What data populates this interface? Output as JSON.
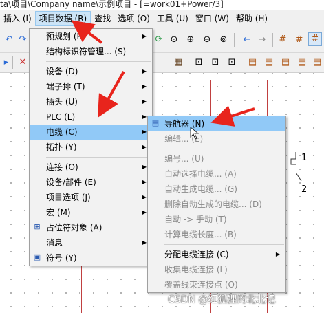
{
  "window": {
    "title": "ta\\项目\\Company name\\示例项目 - [=work01+Power/3]"
  },
  "menubar": [
    "插入 (I)",
    "项目数据 (R)",
    "查找",
    "选项 (O)",
    "工具 (U)",
    "窗口 (W)",
    "帮助 (H)"
  ],
  "menu_project": [
    {
      "label": "预规划 (P)",
      "sub": true
    },
    {
      "label": "结构标识符管理... (S)",
      "sub": false
    },
    {
      "sep": true
    },
    {
      "label": "设备 (D)",
      "sub": true
    },
    {
      "label": "端子排 (T)",
      "sub": true
    },
    {
      "label": "插头 (U)",
      "sub": true
    },
    {
      "label": "PLC (L)",
      "sub": true
    },
    {
      "label": "电缆 (C)",
      "sub": true,
      "highlight": true
    },
    {
      "label": "拓扑 (Y)",
      "sub": true
    },
    {
      "sep": true
    },
    {
      "label": "连接 (O)",
      "sub": true
    },
    {
      "label": "设备/部件 (E)",
      "sub": true
    },
    {
      "label": "项目选项 (J)",
      "sub": true
    },
    {
      "label": "宏 (M)",
      "sub": true
    },
    {
      "label": "占位符对象 (A)",
      "sub": false,
      "icon": "placeholder-object-icon"
    },
    {
      "label": "消息",
      "sub": true
    },
    {
      "label": "符号 (Y)",
      "sub": false,
      "icon": "symbol-icon"
    }
  ],
  "menu_cable": [
    {
      "label": "导航器 (N)",
      "highlight": true,
      "icon": "navigator-icon"
    },
    {
      "label": "编辑... (E)",
      "disabled": true
    },
    {
      "sep": true
    },
    {
      "label": "编号... (U)",
      "disabled": true
    },
    {
      "label": "自动选择电缆... (A)",
      "disabled": true
    },
    {
      "label": "自动生成电缆... (G)",
      "disabled": true
    },
    {
      "label": "删除自动生成的电缆... (D)",
      "disabled": true
    },
    {
      "label": "自动 -> 手动 (T)",
      "disabled": true
    },
    {
      "label": "计算电缆长度... (B)",
      "disabled": true
    },
    {
      "sep": true
    },
    {
      "label": "分配电缆连接 (C)",
      "sub": true
    },
    {
      "label": "收集电缆连接 (L)",
      "disabled": true
    },
    {
      "label": "覆盖线束连接点 (O)",
      "disabled": true
    }
  ],
  "canvas": {
    "pin1": "1",
    "pin2": "2"
  },
  "watermark": "CSDN @红狐狸的北北记",
  "colors": {
    "highlight": "#91c9f7",
    "annotation_arrow": "#e8241c",
    "wire": "#c04040"
  }
}
